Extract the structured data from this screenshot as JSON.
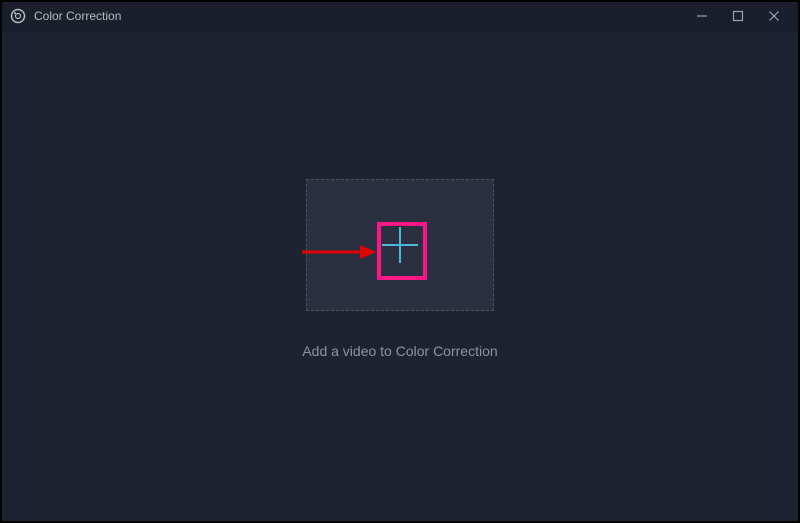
{
  "window": {
    "title": "Color Correction"
  },
  "main": {
    "hint": "Add a video to Color Correction"
  },
  "icons": {
    "app": "app-circle-icon",
    "minimize": "minimize-icon",
    "maximize": "maximize-icon",
    "close": "close-icon",
    "plus": "plus-icon"
  }
}
